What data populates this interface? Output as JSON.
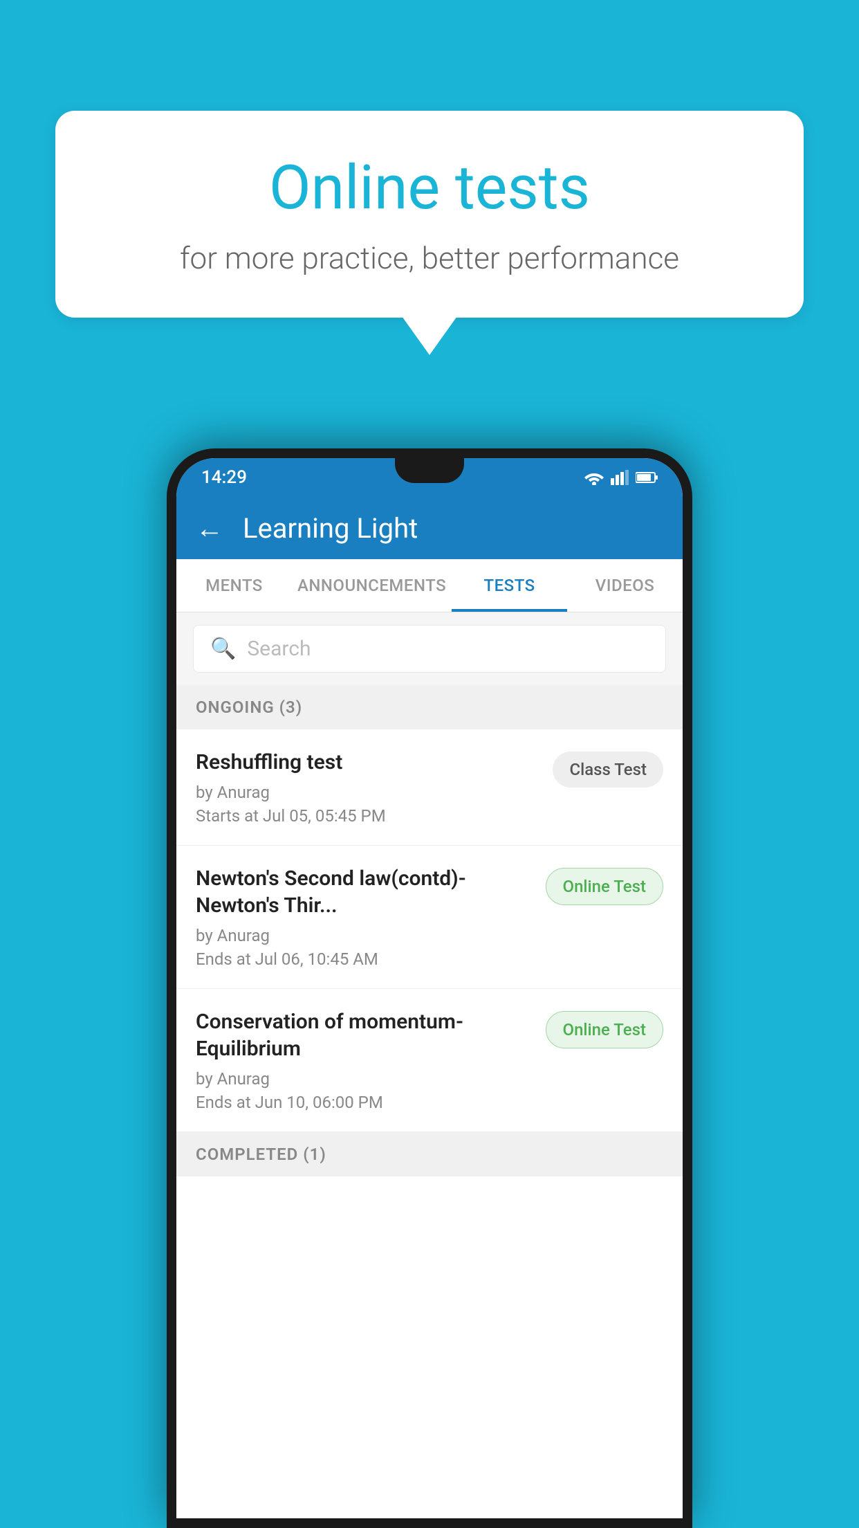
{
  "background_color": "#1ab4d7",
  "speech_bubble": {
    "title": "Online tests",
    "subtitle": "for more practice, better performance"
  },
  "phone": {
    "status_bar": {
      "time": "14:29"
    },
    "app_bar": {
      "title": "Learning Light",
      "back_label": "←"
    },
    "tabs": [
      {
        "label": "MENTS",
        "active": false
      },
      {
        "label": "ANNOUNCEMENTS",
        "active": false
      },
      {
        "label": "TESTS",
        "active": true
      },
      {
        "label": "VIDEOS",
        "active": false
      }
    ],
    "search": {
      "placeholder": "Search"
    },
    "ongoing_section": {
      "label": "ONGOING (3)"
    },
    "tests": [
      {
        "name": "Reshuffling test",
        "by": "by Anurag",
        "date": "Starts at  Jul 05, 05:45 PM",
        "badge": "Class Test",
        "badge_type": "class"
      },
      {
        "name": "Newton's Second law(contd)-Newton's Thir...",
        "by": "by Anurag",
        "date": "Ends at  Jul 06, 10:45 AM",
        "badge": "Online Test",
        "badge_type": "online"
      },
      {
        "name": "Conservation of momentum-Equilibrium",
        "by": "by Anurag",
        "date": "Ends at  Jun 10, 06:00 PM",
        "badge": "Online Test",
        "badge_type": "online"
      }
    ],
    "completed_section": {
      "label": "COMPLETED (1)"
    }
  }
}
